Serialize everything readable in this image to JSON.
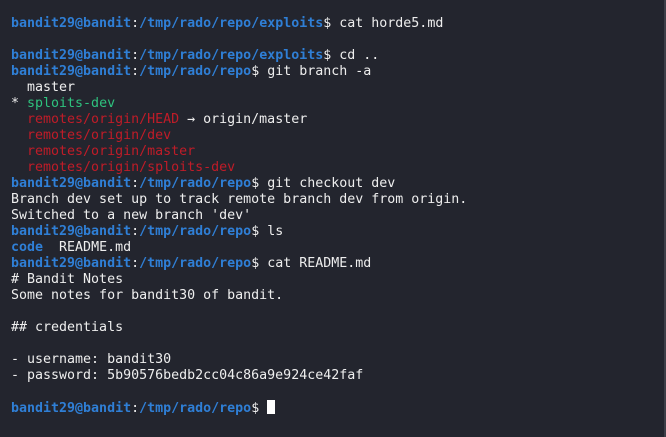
{
  "prompt": {
    "user_host": "bandit29@bandit",
    "colon": ":",
    "dollar": "$"
  },
  "colors": {
    "background": "#23252e",
    "prompt_blue": "#2f7fd6",
    "branch_green": "#2ec27e",
    "remote_red": "#c01c28",
    "text": "#eeeeee"
  },
  "lines": {
    "l1_path": "/tmp/rado/repo/exploits",
    "l1_cmd": " cat horde5.md",
    "l3_path": "/tmp/rado/repo/exploits",
    "l3_cmd": " cd ..",
    "l4_path": "/tmp/rado/repo",
    "l4_cmd": " git branch -a",
    "branch_master": "  master",
    "branch_current_marker": "* ",
    "branch_current": "sploits-dev",
    "indent": "  ",
    "remote_head": "remotes/origin/HEAD",
    "remote_head_arrow": " → origin/master",
    "remote_dev": "remotes/origin/dev",
    "remote_master": "remotes/origin/master",
    "remote_sploits": "remotes/origin/sploits-dev",
    "l11_path": "/tmp/rado/repo",
    "l11_cmd": " git checkout dev",
    "out_tracking": "Branch dev set up to track remote branch dev from origin.",
    "out_switched": "Switched to a new branch 'dev'",
    "l14_path": "/tmp/rado/repo",
    "l14_cmd": " ls",
    "ls_dir": "code",
    "ls_file": "  README.md",
    "l16_path": "/tmp/rado/repo",
    "l16_cmd": " cat README.md",
    "readme_title": "# Bandit Notes",
    "readme_desc": "Some notes for bandit30 of bandit.",
    "readme_section": "## credentials",
    "readme_username": "- username: bandit30",
    "readme_password": "- password: 5b90576bedb2cc04c86a9e924ce42faf",
    "l24_path": "/tmp/rado/repo",
    "l24_cmd": " "
  }
}
